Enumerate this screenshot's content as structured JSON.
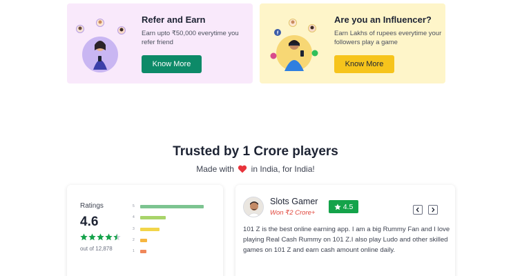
{
  "promos": [
    {
      "title": "Refer and Earn",
      "description": "Earn upto ₹50,000 everytime you refer friend",
      "button_label": "Know More",
      "background": "#f9e9fb",
      "button_color": "#0d8a68"
    },
    {
      "title": "Are you an Influencer?",
      "description": "Earn Lakhs of rupees everytime your followers play a game",
      "button_label": "Know More",
      "background": "#fef5c9",
      "button_color": "#f6c41c"
    }
  ],
  "trusted": {
    "title": "Trusted by 1 Crore players",
    "made_with_prefix": "Made with",
    "made_with_suffix": "in India, for India!",
    "heart_icon": "heart-icon",
    "heart_color": "#e8343c"
  },
  "ratings": {
    "label": "Ratings",
    "value": "4.6",
    "stars_filled": 4.5,
    "star_color": "#14a34a",
    "count_text": "out of 12,878",
    "distribution": [
      {
        "star": "5",
        "fraction": 0.85,
        "color": "#7cc490"
      },
      {
        "star": "4",
        "fraction": 0.34,
        "color": "#a8d46a"
      },
      {
        "star": "3",
        "fraction": 0.26,
        "color": "#f2d54a"
      },
      {
        "star": "2",
        "fraction": 0.09,
        "color": "#f6b640"
      },
      {
        "star": "1",
        "fraction": 0.08,
        "color": "#f0875a"
      }
    ]
  },
  "review": {
    "name": "Slots Gamer",
    "won_text": "Won ₹2 Crore+",
    "score": "4.5",
    "score_color": "#14a34a",
    "text": "101 Z is the best online earning app. I am a big Rummy Fan and I love playing Real Cash Rummy on 101 Z.I also play Ludo and other skilled games on 101 Z and earn cash amount online daily.",
    "prev_icon": "chevron-left-icon",
    "next_icon": "chevron-right-icon"
  }
}
